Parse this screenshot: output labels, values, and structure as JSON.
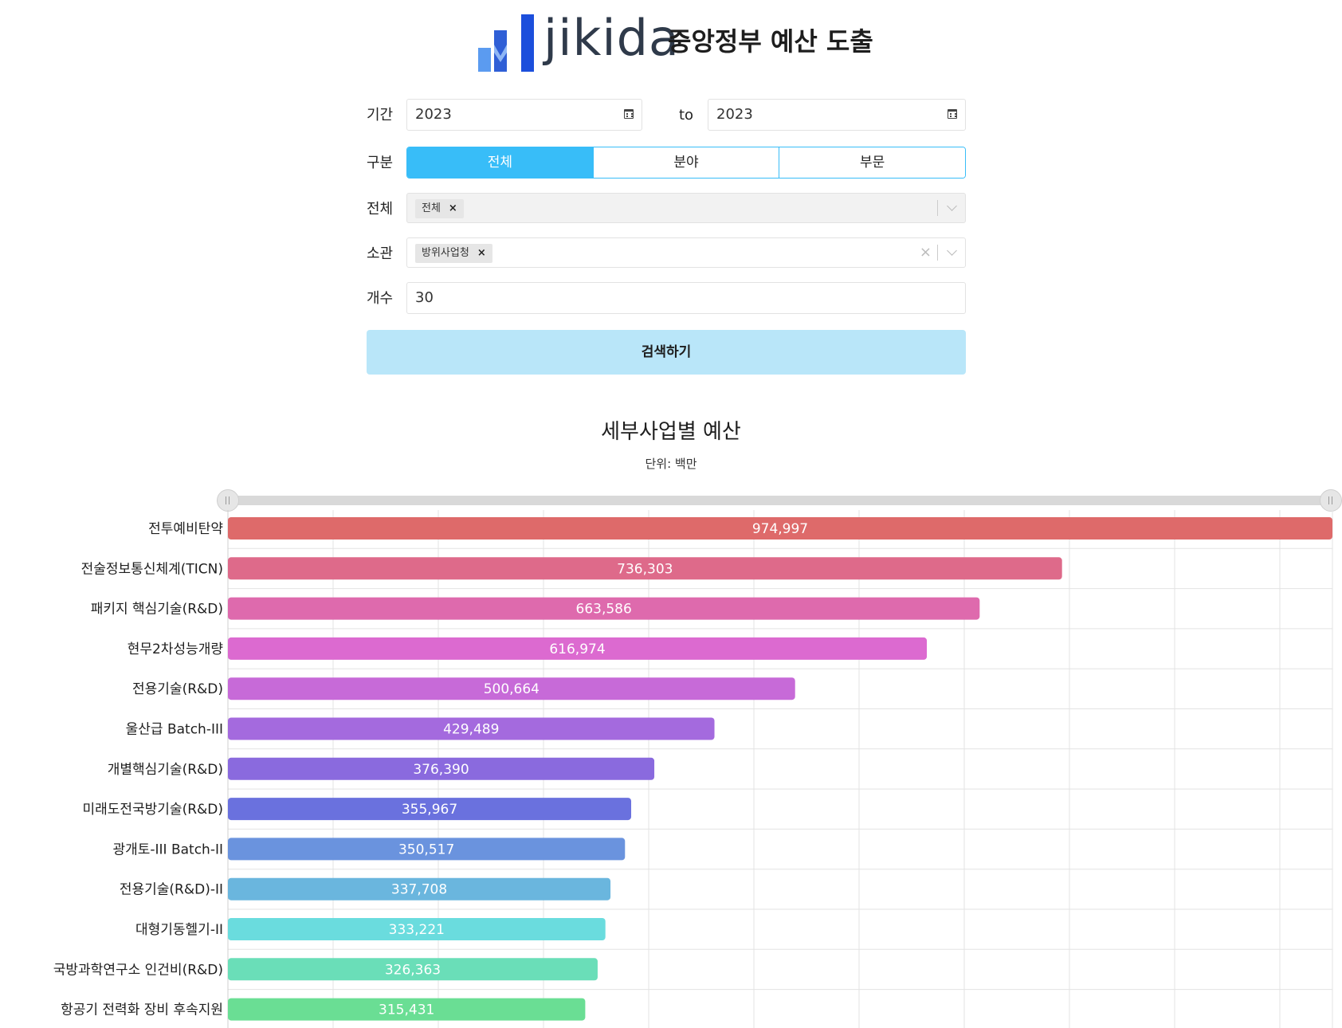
{
  "header": {
    "logo_text": "jikida",
    "title": "중앙정부 예산 도출"
  },
  "form": {
    "period": {
      "label": "기간",
      "from": "2023",
      "to_label": "to",
      "to": "2023"
    },
    "category": {
      "label": "구분",
      "options": [
        "전체",
        "분야",
        "부문"
      ],
      "selected": 0
    },
    "scope": {
      "label": "전체",
      "chip": "전체",
      "disabled": true
    },
    "ministry": {
      "label": "소관",
      "chip": "방위사업청"
    },
    "count": {
      "label": "개수",
      "value": "30"
    },
    "search_label": "검색하기"
  },
  "colors": {
    "accent": "#38bdf8",
    "search_button": "#b9e6f9"
  },
  "chart_data": {
    "type": "bar",
    "orientation": "horizontal",
    "title": "세부사업별 예산",
    "subtitle": "단위: 백만",
    "xlim": [
      0,
      975000
    ],
    "grid": true,
    "categories": [
      "전투예비탄약",
      "전술정보통신체계(TICN)",
      "패키지 핵심기술(R&D)",
      "현무2차성능개량",
      "전용기술(R&D)",
      "울산급 Batch-III",
      "개별핵심기술(R&D)",
      "미래도전국방기술(R&D)",
      "광개토-III Batch-II",
      "전용기술(R&D)-II",
      "대형기동헬기-II",
      "국방과학연구소 인건비(R&D)",
      "항공기 전력화 장비 후속지원"
    ],
    "values": [
      974997,
      736303,
      663586,
      616974,
      500664,
      429489,
      376390,
      355967,
      350517,
      337708,
      333221,
      326363,
      315431
    ],
    "value_labels": [
      "974,997",
      "736,303",
      "663,586",
      "616,974",
      "500,664",
      "429,489",
      "376,390",
      "355,967",
      "350,517",
      "337,708",
      "333,221",
      "326,363",
      "315,431"
    ],
    "bar_colors": [
      "#de6a6a",
      "#de6a8a",
      "#de6aad",
      "#dc6ad0",
      "#c76ad8",
      "#a46ade",
      "#8a6ade",
      "#6a71de",
      "#6a93de",
      "#6ab6de",
      "#6adcde",
      "#6adeb8",
      "#6ade94"
    ]
  }
}
